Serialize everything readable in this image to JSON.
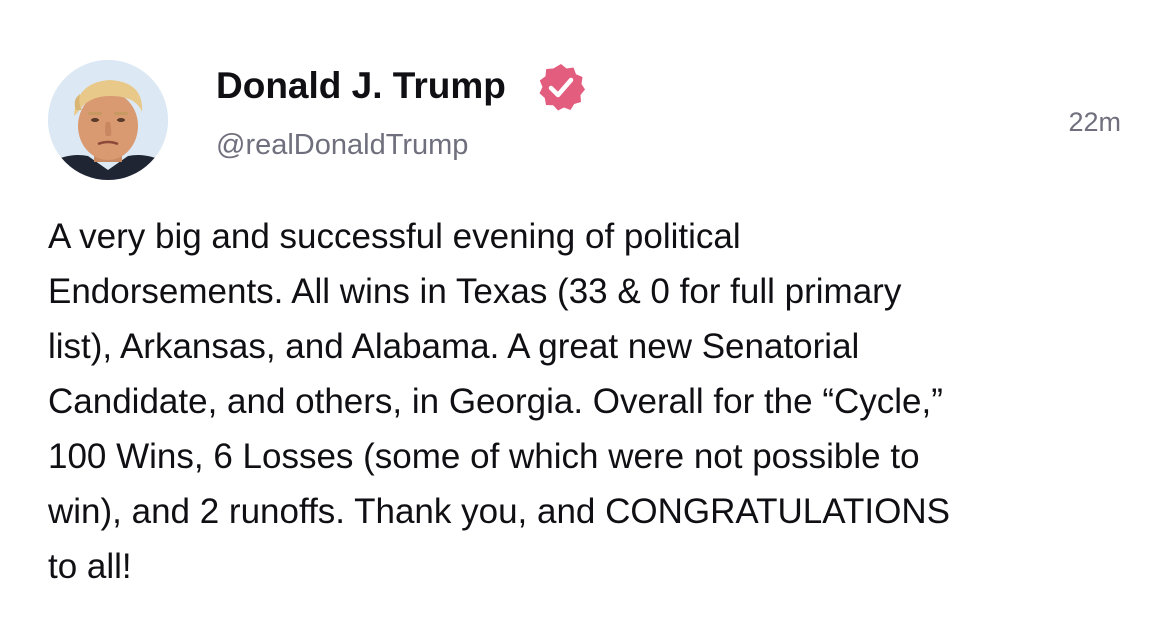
{
  "post": {
    "author": {
      "display_name": "Donald J. Trump",
      "handle": "@realDonaldTrump",
      "verified": true
    },
    "timestamp": "22m",
    "text_lines": [
      "A very big and successful evening of political",
      "Endorsements. All wins in Texas (33 & 0 for full primary",
      "list), Arkansas, and Alabama. A great new Senatorial",
      "Candidate, and others, in Georgia. Overall for the “Cycle,”",
      "100 Wins, 6 Losses (some of which were not possible to",
      "win), and 2 runoffs. Thank you, and CONGRATULATIONS",
      "to all!"
    ]
  },
  "colors": {
    "text": "#0f0f14",
    "muted": "#6f6f7d",
    "verified_badge": "#e35d7e",
    "background": "#ffffff"
  },
  "icons": {
    "verified": "verified-badge-icon",
    "avatar": "profile-avatar"
  }
}
